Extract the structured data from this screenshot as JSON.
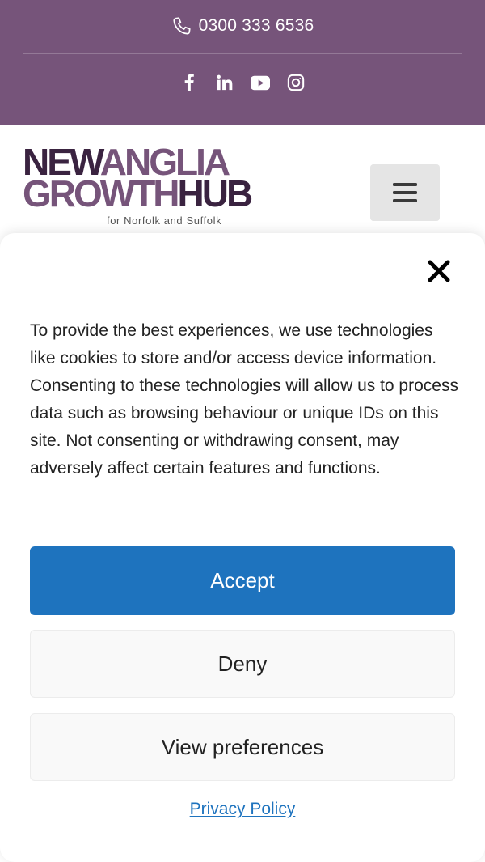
{
  "topbar": {
    "phone": "0300 333 6536",
    "social_icons": [
      "facebook-icon",
      "linkedin-icon",
      "youtube-icon",
      "instagram-icon"
    ],
    "background_color": "#76547a"
  },
  "header": {
    "logo": {
      "line1_part1": "NEW",
      "line1_part2": "ANGLIA",
      "line2_part1": "GROWTH",
      "line2_part2": "HUB",
      "tagline": "for Norfolk and Suffolk"
    },
    "menu_icon": "hamburger-icon"
  },
  "consent": {
    "close_icon": "close-icon",
    "message": "To provide the best experiences, we use technologies like cookies to store and/or access device information. Consenting to these technologies will allow us to process data such as browsing behaviour or unique IDs on this site. Not consenting or withdrawing consent, may adversely affect certain features and functions.",
    "accept_label": "Accept",
    "deny_label": "Deny",
    "preferences_label": "View preferences",
    "privacy_link": "Privacy Policy",
    "accent_color": "#1e73be"
  }
}
